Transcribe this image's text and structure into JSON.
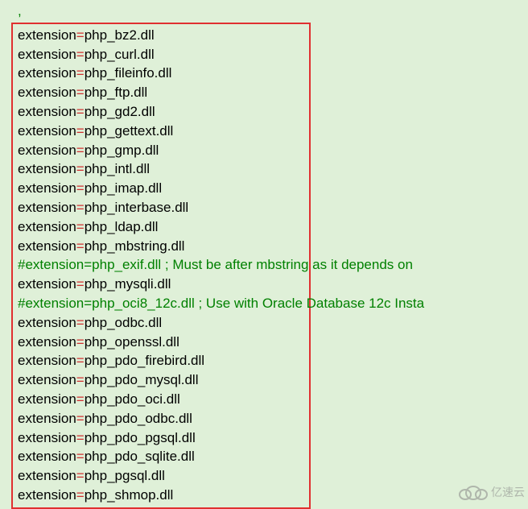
{
  "top_char": ",",
  "lines": [
    {
      "type": "ext",
      "key": "extension",
      "value": "php_bz2.dll"
    },
    {
      "type": "ext",
      "key": "extension",
      "value": "php_curl.dll"
    },
    {
      "type": "ext",
      "key": "extension",
      "value": "php_fileinfo.dll"
    },
    {
      "type": "ext",
      "key": "extension",
      "value": "php_ftp.dll"
    },
    {
      "type": "ext",
      "key": "extension",
      "value": "php_gd2.dll"
    },
    {
      "type": "ext",
      "key": "extension",
      "value": "php_gettext.dll"
    },
    {
      "type": "ext",
      "key": "extension",
      "value": "php_gmp.dll"
    },
    {
      "type": "ext",
      "key": "extension",
      "value": "php_intl.dll"
    },
    {
      "type": "ext",
      "key": "extension",
      "value": "php_imap.dll"
    },
    {
      "type": "ext",
      "key": "extension",
      "value": "php_interbase.dll"
    },
    {
      "type": "ext",
      "key": "extension",
      "value": "php_ldap.dll"
    },
    {
      "type": "ext",
      "key": "extension",
      "value": "php_mbstring.dll"
    },
    {
      "type": "comment",
      "text": "#extension=php_exif.dll      ; Must be after mbstring as it depends on"
    },
    {
      "type": "ext",
      "key": "extension",
      "value": "php_mysqli.dll"
    },
    {
      "type": "comment",
      "text": "#extension=php_oci8_12c.dll  ; Use with Oracle Database 12c Insta"
    },
    {
      "type": "ext",
      "key": "extension",
      "value": "php_odbc.dll"
    },
    {
      "type": "ext",
      "key": "extension",
      "value": "php_openssl.dll"
    },
    {
      "type": "ext",
      "key": "extension",
      "value": "php_pdo_firebird.dll"
    },
    {
      "type": "ext",
      "key": "extension",
      "value": "php_pdo_mysql.dll"
    },
    {
      "type": "ext",
      "key": "extension",
      "value": "php_pdo_oci.dll"
    },
    {
      "type": "ext",
      "key": "extension",
      "value": "php_pdo_odbc.dll"
    },
    {
      "type": "ext",
      "key": "extension",
      "value": "php_pdo_pgsql.dll"
    },
    {
      "type": "ext",
      "key": "extension",
      "value": "php_pdo_sqlite.dll"
    },
    {
      "type": "ext",
      "key": "extension",
      "value": "php_pgsql.dll"
    },
    {
      "type": "ext",
      "key": "extension",
      "value": "php_shmop.dll"
    }
  ],
  "watermark": {
    "text": "亿速云"
  },
  "colors": {
    "equals": "#d03030",
    "comment": "#008000",
    "border": "#e03030",
    "background": "#dff0d8"
  }
}
